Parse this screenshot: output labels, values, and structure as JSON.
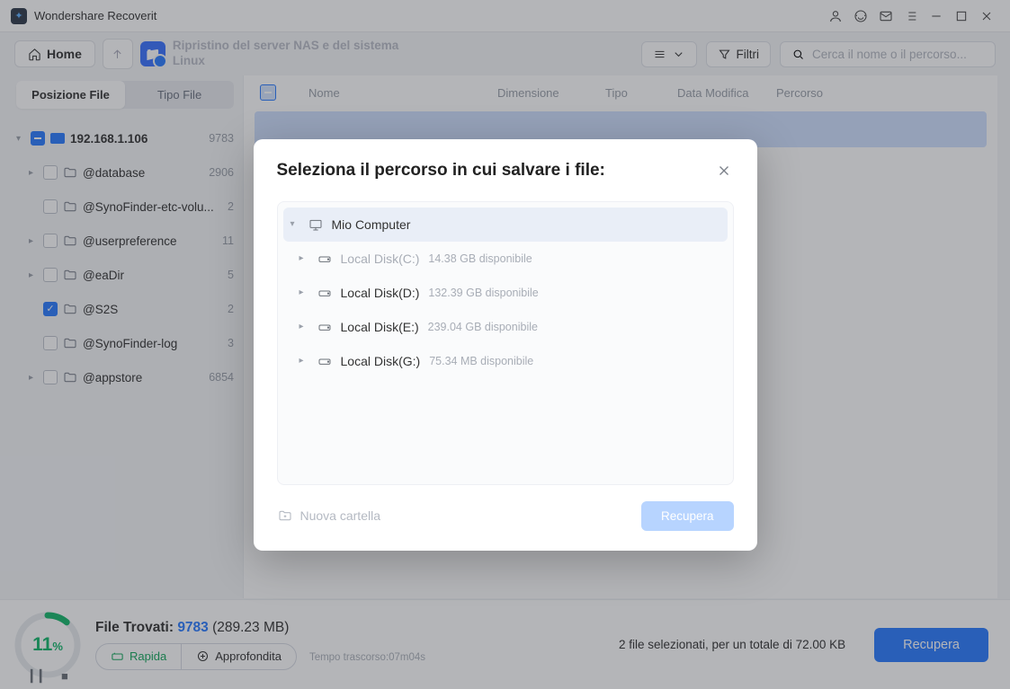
{
  "titlebar": {
    "title": "Wondershare Recoverit"
  },
  "toolbar": {
    "home_label": "Home",
    "section_label": "Ripristino del server NAS e del sistema Linux",
    "filter_label": "Filtri",
    "search_placeholder": "Cerca il nome o il percorso..."
  },
  "sidebar": {
    "tab_pos": "Posizione File",
    "tab_tipo": "Tipo File",
    "root": {
      "label": "192.168.1.106",
      "count": "9783"
    },
    "children": [
      {
        "label": "@database",
        "count": "2906",
        "checked": false,
        "caret": true
      },
      {
        "label": "@SynoFinder-etc-volu...",
        "count": "2",
        "checked": false,
        "caret": false
      },
      {
        "label": "@userpreference",
        "count": "11",
        "checked": false,
        "caret": true
      },
      {
        "label": "@eaDir",
        "count": "5",
        "checked": false,
        "caret": true
      },
      {
        "label": "@S2S",
        "count": "2",
        "checked": true,
        "caret": false
      },
      {
        "label": "@SynoFinder-log",
        "count": "3",
        "checked": false,
        "caret": false
      },
      {
        "label": "@appstore",
        "count": "6854",
        "checked": false,
        "caret": true
      }
    ]
  },
  "content": {
    "columns": {
      "nome": "Nome",
      "dim": "Dimensione",
      "tipo": "Tipo",
      "data": "Data Modifica",
      "percorso": "Percorso"
    }
  },
  "footer": {
    "percent": "11",
    "percent_sym": "%",
    "found_label": "File Trovati: ",
    "found_count": "9783",
    "found_size": " (289.23 MB)",
    "mode_rapida": "Rapida",
    "mode_approf": "Approfondita",
    "elapsed": "Tempo trascorso:07m04s",
    "sel_info": "2 file selezionati, per un totale di 72.00 KB",
    "recover_label": "Recupera"
  },
  "modal": {
    "title": "Seleziona il percorso in cui salvare i file:",
    "root_label": "Mio Computer",
    "drives": [
      {
        "name": "Local Disk(C:)",
        "avail": "14.38 GB disponibile",
        "muted": true
      },
      {
        "name": "Local Disk(D:)",
        "avail": "132.39 GB disponibile",
        "muted": false
      },
      {
        "name": "Local Disk(E:)",
        "avail": "239.04 GB disponibile",
        "muted": false
      },
      {
        "name": "Local Disk(G:)",
        "avail": "75.34 MB disponibile",
        "muted": false
      }
    ],
    "new_folder_label": "Nuova cartella",
    "recover_label": "Recupera"
  }
}
